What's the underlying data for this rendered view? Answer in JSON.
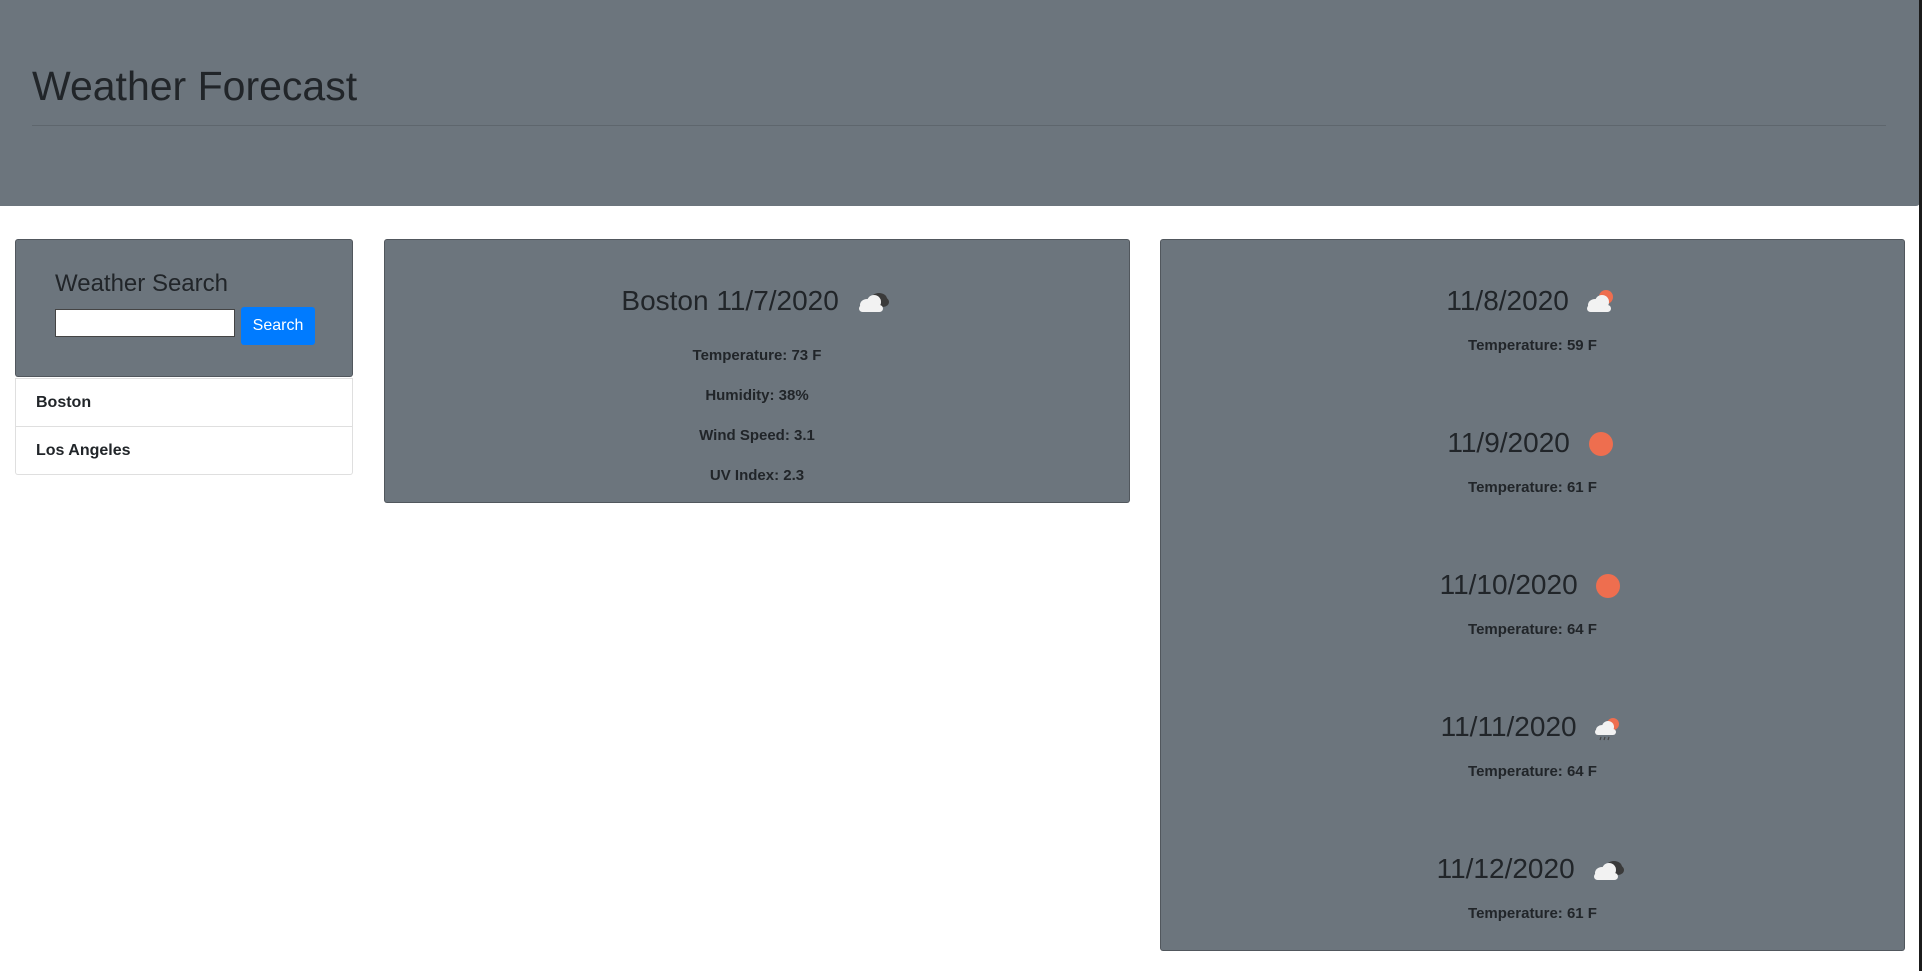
{
  "header": {
    "title": "Weather Forecast"
  },
  "search": {
    "title": "Weather Search",
    "input_value": "",
    "button_label": "Search"
  },
  "history": [
    {
      "label": "Boston"
    },
    {
      "label": "Los Angeles"
    }
  ],
  "current": {
    "heading": "Boston 11/7/2020",
    "icon": "broken-clouds-icon",
    "temperature": "Temperature: 73 F",
    "humidity": "Humidity: 38%",
    "wind": "Wind Speed: 3.1",
    "uv": "UV Index: 2.3"
  },
  "forecast": [
    {
      "date": "11/8/2020",
      "icon": "few-clouds-icon",
      "temperature": "Temperature: 59 F"
    },
    {
      "date": "11/9/2020",
      "icon": "clear-sky-icon",
      "temperature": "Temperature: 61 F"
    },
    {
      "date": "11/10/2020",
      "icon": "clear-sky-icon",
      "temperature": "Temperature: 64 F"
    },
    {
      "date": "11/11/2020",
      "icon": "rain-icon",
      "temperature": "Temperature: 64 F"
    },
    {
      "date": "11/12/2020",
      "icon": "broken-clouds-icon",
      "temperature": "Temperature: 61 F"
    }
  ],
  "colors": {
    "panel": "#6c757d",
    "accent": "#007bff",
    "sun": "#ee6e4f"
  }
}
